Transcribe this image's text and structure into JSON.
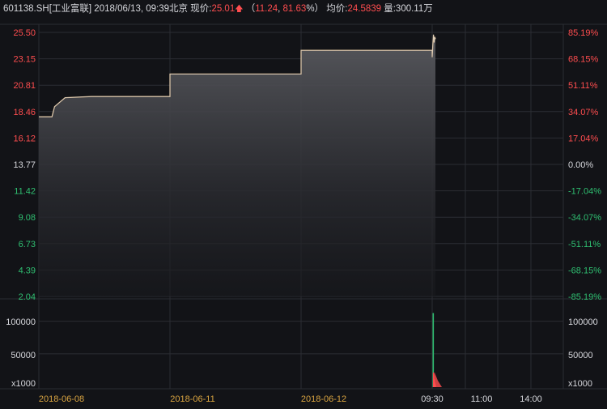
{
  "header": {
    "symbol": "601138.SH[工业富联]",
    "datetime": "2018/06/13, 09:39北京",
    "price_label": "现价:",
    "price_value": "25.01",
    "change_open": "（",
    "change_value": "11.24",
    "change_sep": ", ",
    "change_pct": "81.63",
    "change_close": "%）",
    "avg_label": "均价:",
    "avg_value": "24.5839",
    "vol_label": "量:300.11万"
  },
  "colors": {
    "background": "#121317",
    "grid": "#2b2d33",
    "up": "#ff4d4f",
    "down": "#2fbf71",
    "neutral": "#d6d7dc",
    "price_line": "#d2b48c",
    "volume_up": "#ff4d4f",
    "volume_down": "#2fbf71"
  },
  "chart_data": {
    "type": "area",
    "price_axis_left": [
      "25.50",
      "23.15",
      "20.81",
      "18.46",
      "16.12",
      "13.77",
      "11.42",
      "9.08",
      "6.73",
      "4.39",
      "2.04"
    ],
    "price_axis_right": [
      "85.19%",
      "68.15%",
      "51.11%",
      "34.07%",
      "17.04%",
      "0.00%",
      "-17.04%",
      "-34.07%",
      "-51.11%",
      "-68.15%",
      "-85.19%"
    ],
    "volume_axis_left": [
      "100000",
      "50000",
      "x1000"
    ],
    "volume_axis_right": [
      "100000",
      "50000",
      "x1000"
    ],
    "x_labels": [
      "2018-06-08",
      "2018-06-11",
      "2018-06-12",
      "09:30",
      "11:00",
      "14:00"
    ],
    "price_ylim": [
      2.04,
      25.5
    ],
    "volume_ylim": [
      0,
      120000
    ],
    "price_series": [
      {
        "x": 0.0,
        "y": 18.0
      },
      {
        "x": 0.1,
        "y": 18.0
      },
      {
        "x": 0.12,
        "y": 18.9
      },
      {
        "x": 0.2,
        "y": 19.7
      },
      {
        "x": 0.4,
        "y": 19.8
      },
      {
        "x": 1.0,
        "y": 19.8
      },
      {
        "x": 1.0,
        "y": 21.8
      },
      {
        "x": 2.0,
        "y": 21.8
      },
      {
        "x": 2.0,
        "y": 23.9
      },
      {
        "x": 3.0,
        "y": 23.9
      },
      {
        "x": 3.0,
        "y": 23.3
      },
      {
        "x": 3.005,
        "y": 24.4
      },
      {
        "x": 3.01,
        "y": 25.3
      },
      {
        "x": 3.015,
        "y": 24.6
      },
      {
        "x": 3.02,
        "y": 25.1
      },
      {
        "x": 3.025,
        "y": 24.9
      }
    ],
    "volume_series": [
      {
        "x": 3.0,
        "v": 112000,
        "dir": "down"
      },
      {
        "x": 3.003,
        "v": 22000,
        "dir": "up"
      },
      {
        "x": 3.007,
        "v": 12000,
        "dir": "up"
      },
      {
        "x": 3.011,
        "v": 7000,
        "dir": "up"
      },
      {
        "x": 3.015,
        "v": 4000,
        "dir": "up"
      }
    ]
  }
}
